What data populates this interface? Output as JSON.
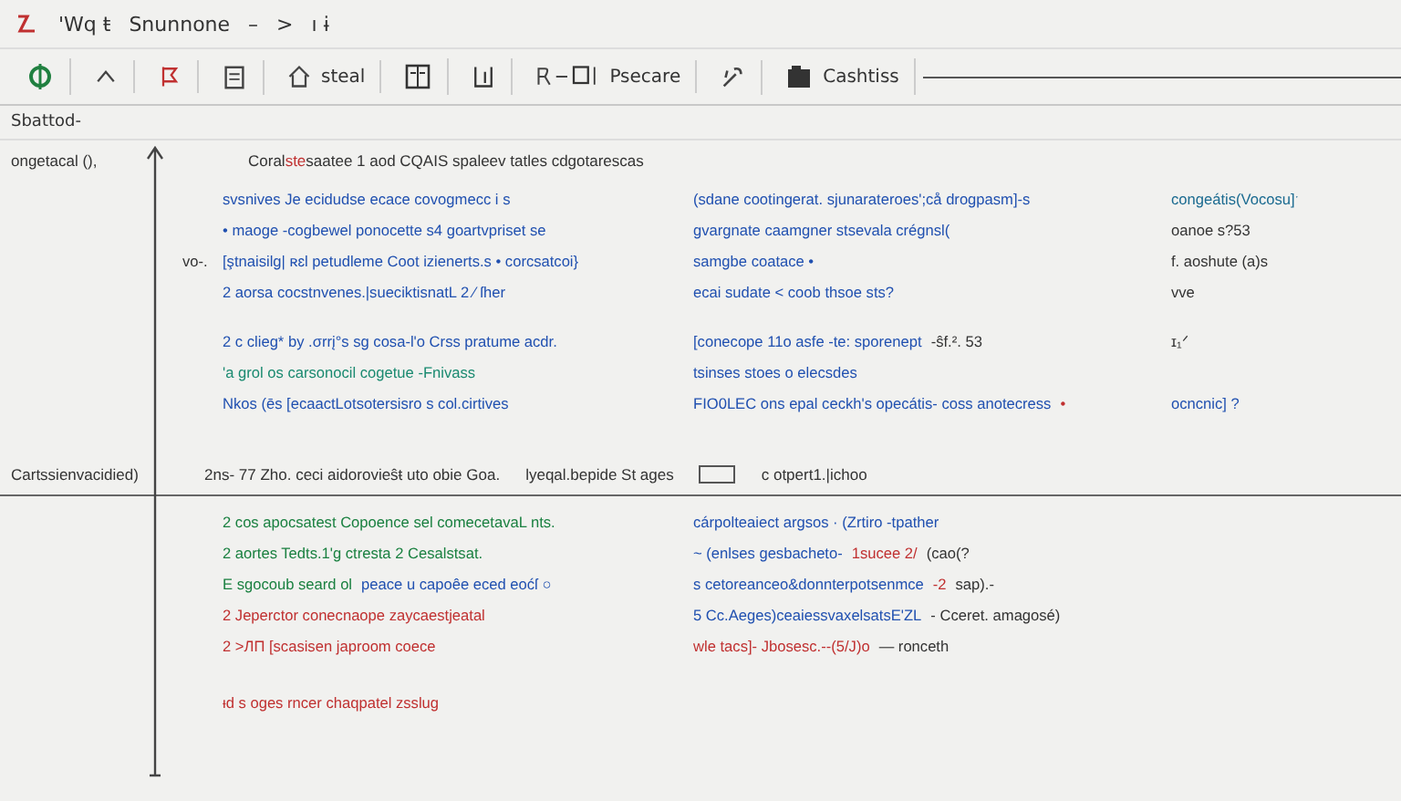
{
  "title_bar": {
    "items": [
      "'Wq ŧ",
      "Snunnone",
      "–",
      ">",
      "ı ɨ"
    ]
  },
  "toolbar": {
    "items": [
      {
        "kind": "icon"
      },
      {
        "kind": "icon"
      },
      {
        "kind": "icon"
      },
      {
        "kind": "icon"
      },
      {
        "kind": "label",
        "text": "steal"
      },
      {
        "kind": "icon"
      },
      {
        "kind": "icon"
      },
      {
        "kind": "label",
        "text": "Psecare"
      },
      {
        "kind": "icon"
      },
      {
        "kind": "label",
        "text": "Cashtiss"
      }
    ]
  },
  "path": "Sbattod-",
  "sections": [
    {
      "label": "ongetacal (),",
      "header": [
        {
          "kind": "text",
          "text": "Coral",
          "color": "#333333"
        },
        {
          "kind": "text",
          "text": "ste",
          "color": "#c03030"
        },
        {
          "kind": "text",
          "text": " saatee 1 aod CQAIS spaleev tatles cdgotarescas",
          "color": "#333333"
        }
      ],
      "lines": [
        {
          "left": [
            {
              "text": "svsnives Je ecidudse ecace covogmecc i s",
              "color": "#2050b0"
            }
          ],
          "middle": [
            {
              "text": "(sdane cootingerat. sjunarateroes';cå drogpasm]-s",
              "color": "#2050b0"
            }
          ],
          "right": [
            {
              "text": "congeátis(Vocosu]ˑ",
              "color": "#1a6a90"
            }
          ]
        },
        {
          "left": [
            {
              "text": "• maoge -cogbewel ponocette s4 goartvpriset se",
              "color": "#2050b0"
            }
          ],
          "middle": [
            {
              "text": "gvargnate caamgner stsevala crégnsl(",
              "color": "#2050b0"
            }
          ],
          "right": [
            {
              "text": "oanoe s?53",
              "color": "#333333"
            }
          ]
        },
        {
          "prefix": "vo-.",
          "left": [
            {
              "text": "[ştnaisilg| ʀɛl petudleme Coot izienerts.s • corcsatcoi}",
              "color": "#2050b0"
            }
          ],
          "middle": [
            {
              "text": "samgbe coatace •",
              "color": "#2050b0"
            }
          ],
          "right": [
            {
              "text": "f. aoshute (a)s",
              "color": "#333333"
            }
          ]
        },
        {
          "left": [
            {
              "text": "2 aorsa cocstnvenes.|sueciktisnatL 2 ⁄ ſher",
              "color": "#2050b0"
            }
          ],
          "middle": [
            {
              "text": "ecai sudate < coob thsoe sts?",
              "color": "#2050b0"
            }
          ],
          "right": [
            {
              "text": "vve",
              "color": "#333333"
            }
          ]
        },
        {
          "left": [
            {
              "text": "2 c clieg* by .σrrį°s sg cosa-l'o Crss pratume acdr.",
              "color": "#2050b0"
            }
          ],
          "middle": [
            {
              "text": "[conecope 11o asfe -te: sporenept",
              "color": "#2050b0"
            },
            {
              "text": "-ŝf.². 53",
              "color": "#333333"
            }
          ],
          "right": [
            {
              "text": "ɪ₁ᐟ",
              "color": "#333333"
            }
          ]
        },
        {
          "left": [
            {
              "text": "'a grol os carsonocil cogetue -Fnivass",
              "color": "#1a8a70"
            }
          ],
          "middle": [
            {
              "text": "tsinses stoes o elecsdes",
              "color": "#2050b0"
            }
          ]
        },
        {
          "left": [
            {
              "text": "Nkos (ēs [ecaactLotsotersisro  s col.cirtives",
              "color": "#2050b0"
            }
          ],
          "middle": [
            {
              "text": "FIO0LEC ons epal ceckh's opecátis- coss anotecress",
              "color": "#2050b0"
            },
            {
              "text": "•",
              "color": "#c03030"
            }
          ],
          "right": [
            {
              "text": "ocncnic] ?",
              "color": "#2050b0"
            }
          ]
        }
      ]
    },
    {
      "label": "Cartssienvacidied)",
      "header": [
        {
          "kind": "text",
          "text": "2ns- 77 Zho. ceci aidorovieŝŧ uto obie Goa.",
          "color": "#333333"
        },
        {
          "kind": "text",
          "text": "lyeqal.bepide St ages",
          "color": "#333333"
        },
        {
          "kind": "checkbox",
          "checked": false
        },
        {
          "kind": "text",
          "text": "c otpert1.|ichoo",
          "color": "#333333"
        }
      ],
      "lines": [
        {
          "left": [
            {
              "text": "2 cos apocsatest Copoence sel comecetavaL nts.",
              "color": "#1a8040"
            }
          ],
          "middle": [
            {
              "text": "cárpolteaiect argsos · (Zrtiro -tpather",
              "color": "#2050b0"
            }
          ]
        },
        {
          "left": [
            {
              "text": "2 aortes Tedts.1'g ctresta 2 Cesalstsat.",
              "color": "#1a8040"
            }
          ],
          "middle": [
            {
              "text": "~ (enlses gesbacheto-",
              "color": "#2050b0"
            },
            {
              "text": "1sucee 2/",
              "color": "#c03030"
            },
            {
              "text": "(cao(?",
              "color": "#333333"
            }
          ]
        },
        {
          "left": [
            {
              "text": "E sgocoub seard ol",
              "color": "#1a8040"
            },
            {
              "text": "peace u capoêe eced eoćſ ○",
              "color": "#2050b0"
            }
          ],
          "middle": [
            {
              "text": "s cetoreanceo&donnterpotsenmce",
              "color": "#2050b0"
            },
            {
              "text": "-2",
              "color": "#c03030"
            },
            {
              "text": "sap).-",
              "color": "#333333"
            }
          ]
        },
        {
          "left": [
            {
              "text": "2 Jeperctor conecnaope zaycaestjeatal",
              "color": "#c03030"
            }
          ],
          "middle": [
            {
              "text": "5 Cc.Aeges)ceaiessvaxelsatsE'ZL",
              "color": "#2050b0"
            },
            {
              "text": "- Cceret. amagosé)",
              "color": "#333333"
            }
          ]
        },
        {
          "left": [
            {
              "text": "2 >ЛП [scasisen japroom coece",
              "color": "#c03030"
            }
          ],
          "middle": [
            {
              "text": "wle tacs]- Jbosesc.--(5/J)o",
              "color": "#c03030"
            },
            {
              "text": "— ronceth",
              "color": "#333333"
            }
          ]
        },
        {
          "left": [
            {
              "text": "ᵻd s oges rncer chaqpatel zsslug",
              "color": "#c03030"
            }
          ]
        }
      ]
    }
  ]
}
